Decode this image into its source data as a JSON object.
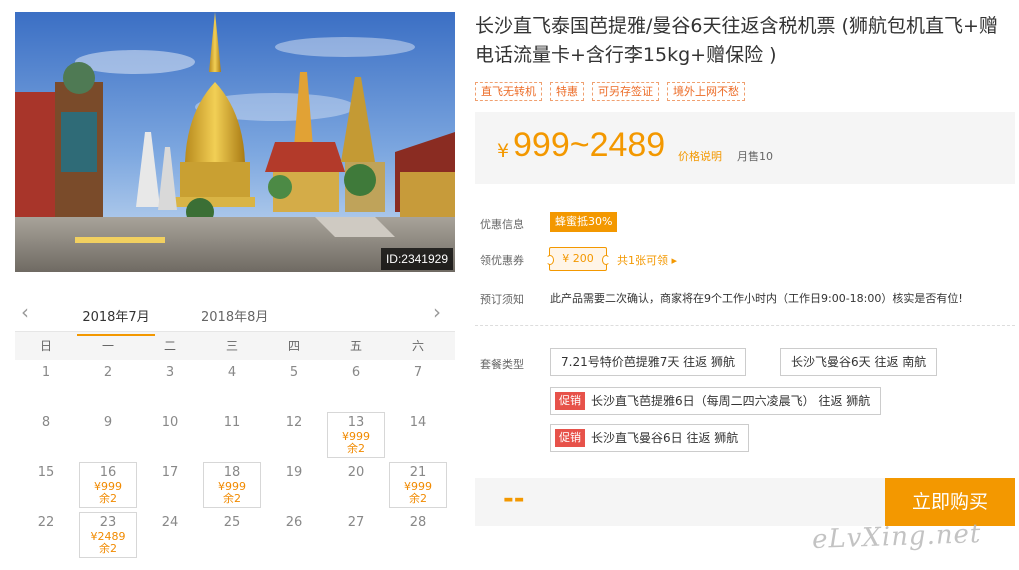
{
  "hero": {
    "image_id": "ID:2341929"
  },
  "calendar": {
    "tabs": [
      "2018年7月",
      "2018年8月"
    ],
    "weekdays": [
      "日",
      "一",
      "二",
      "三",
      "四",
      "五",
      "六"
    ],
    "cells": [
      {
        "day": "1"
      },
      {
        "day": "2"
      },
      {
        "day": "3"
      },
      {
        "day": "4"
      },
      {
        "day": "5"
      },
      {
        "day": "6"
      },
      {
        "day": "7"
      },
      {
        "day": "8"
      },
      {
        "day": "9"
      },
      {
        "day": "10"
      },
      {
        "day": "11"
      },
      {
        "day": "12"
      },
      {
        "day": "13",
        "price": "¥999",
        "left": "余2"
      },
      {
        "day": "14"
      },
      {
        "day": "15"
      },
      {
        "day": "16",
        "price": "¥999",
        "left": "余2"
      },
      {
        "day": "17"
      },
      {
        "day": "18",
        "price": "¥999",
        "left": "余2"
      },
      {
        "day": "19"
      },
      {
        "day": "20"
      },
      {
        "day": "21",
        "price": "¥999",
        "left": "余2"
      },
      {
        "day": "22"
      },
      {
        "day": "23",
        "price": "¥2489",
        "left": "余2"
      },
      {
        "day": "24"
      },
      {
        "day": "25"
      },
      {
        "day": "26"
      },
      {
        "day": "27"
      },
      {
        "day": "28"
      }
    ]
  },
  "product": {
    "title": "长沙直飞泰国芭提雅/曼谷6天往返含税机票 (狮航包机直飞+赠电话流量卡+含行李15kg+赠保险 )",
    "tags": [
      "直飞无转机",
      "特惠",
      "可另存签证",
      "境外上网不愁"
    ],
    "price_currency": "¥",
    "price_range": "999~2489",
    "price_note": "价格说明",
    "monthly_sales": "月售10"
  },
  "promotion": {
    "label": "优惠信息",
    "badge": "蜂蜜抵30%"
  },
  "coupon": {
    "label": "领优惠券",
    "value": "¥ 200",
    "link": "共1张可领 ▸"
  },
  "notice": {
    "label": "预订须知",
    "text": "此产品需要二次确认，商家将在9个工作小时内（工作日9:00-18:00）核实是否有位!"
  },
  "packages": {
    "label": "套餐类型",
    "items": [
      {
        "hot": "",
        "text": "7.21号特价芭提雅7天 往返 狮航"
      },
      {
        "hot": "",
        "text": "长沙飞曼谷6天 往返 南航"
      },
      {
        "hot": "促销",
        "text": "长沙直飞芭提雅6日（每周二四六凌晨飞） 往返 狮航"
      },
      {
        "hot": "促销",
        "text": "长沙直飞曼谷6日 往返 狮航"
      }
    ]
  },
  "purchase": {
    "selected_price": "--",
    "buy_label": "立即购买"
  },
  "watermark": "eLvXing.net",
  "colors": {
    "accent": "#f39800",
    "hot": "#e7524a"
  }
}
